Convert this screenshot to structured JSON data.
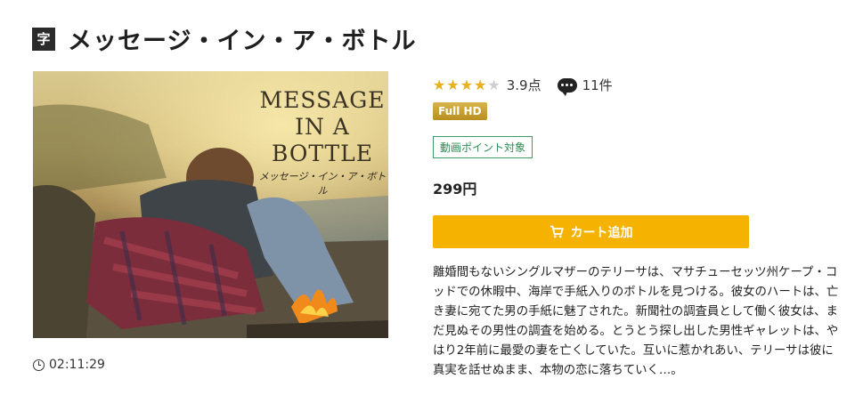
{
  "header": {
    "subtitle_badge": "字",
    "title": "メッセージ・イン・ア・ボトル"
  },
  "poster": {
    "title_lines": [
      "MESSAGE",
      "IN A",
      "BOTTLE"
    ],
    "japanese_title": "メッセージ・イン・ア・ボトル"
  },
  "duration": "02:11:29",
  "rating": {
    "score": 3.9,
    "score_label": "3.9点",
    "stars": "★★★★★",
    "review_count_label": "11件"
  },
  "badges": {
    "quality": "Full HD",
    "points": "動画ポイント対象"
  },
  "price": "299円",
  "cart_button_label": "カート追加",
  "description": "離婚間もないシングルマザーのテリーサは、マサチューセッツ州ケープ・コッドでの休暇中、海岸で手紙入りのボトルを見つける。彼女のハートは、亡き妻に宛てた男の手紙に魅了された。新聞社の調査員として働く彼女は、まだ見ぬその男性の調査を始める。とうとう探し出した男性ギャレットは、やはり2年前に最愛の妻を亡くしていた。互いに惹かれあい、テリーサは彼に真実を話せぬまま、本物の恋に落ちていく…。",
  "colors": {
    "accent": "#f5b200",
    "star": "#e9b21a",
    "point_badge": "#3e9c63",
    "hd_badge": "#c9a235"
  }
}
